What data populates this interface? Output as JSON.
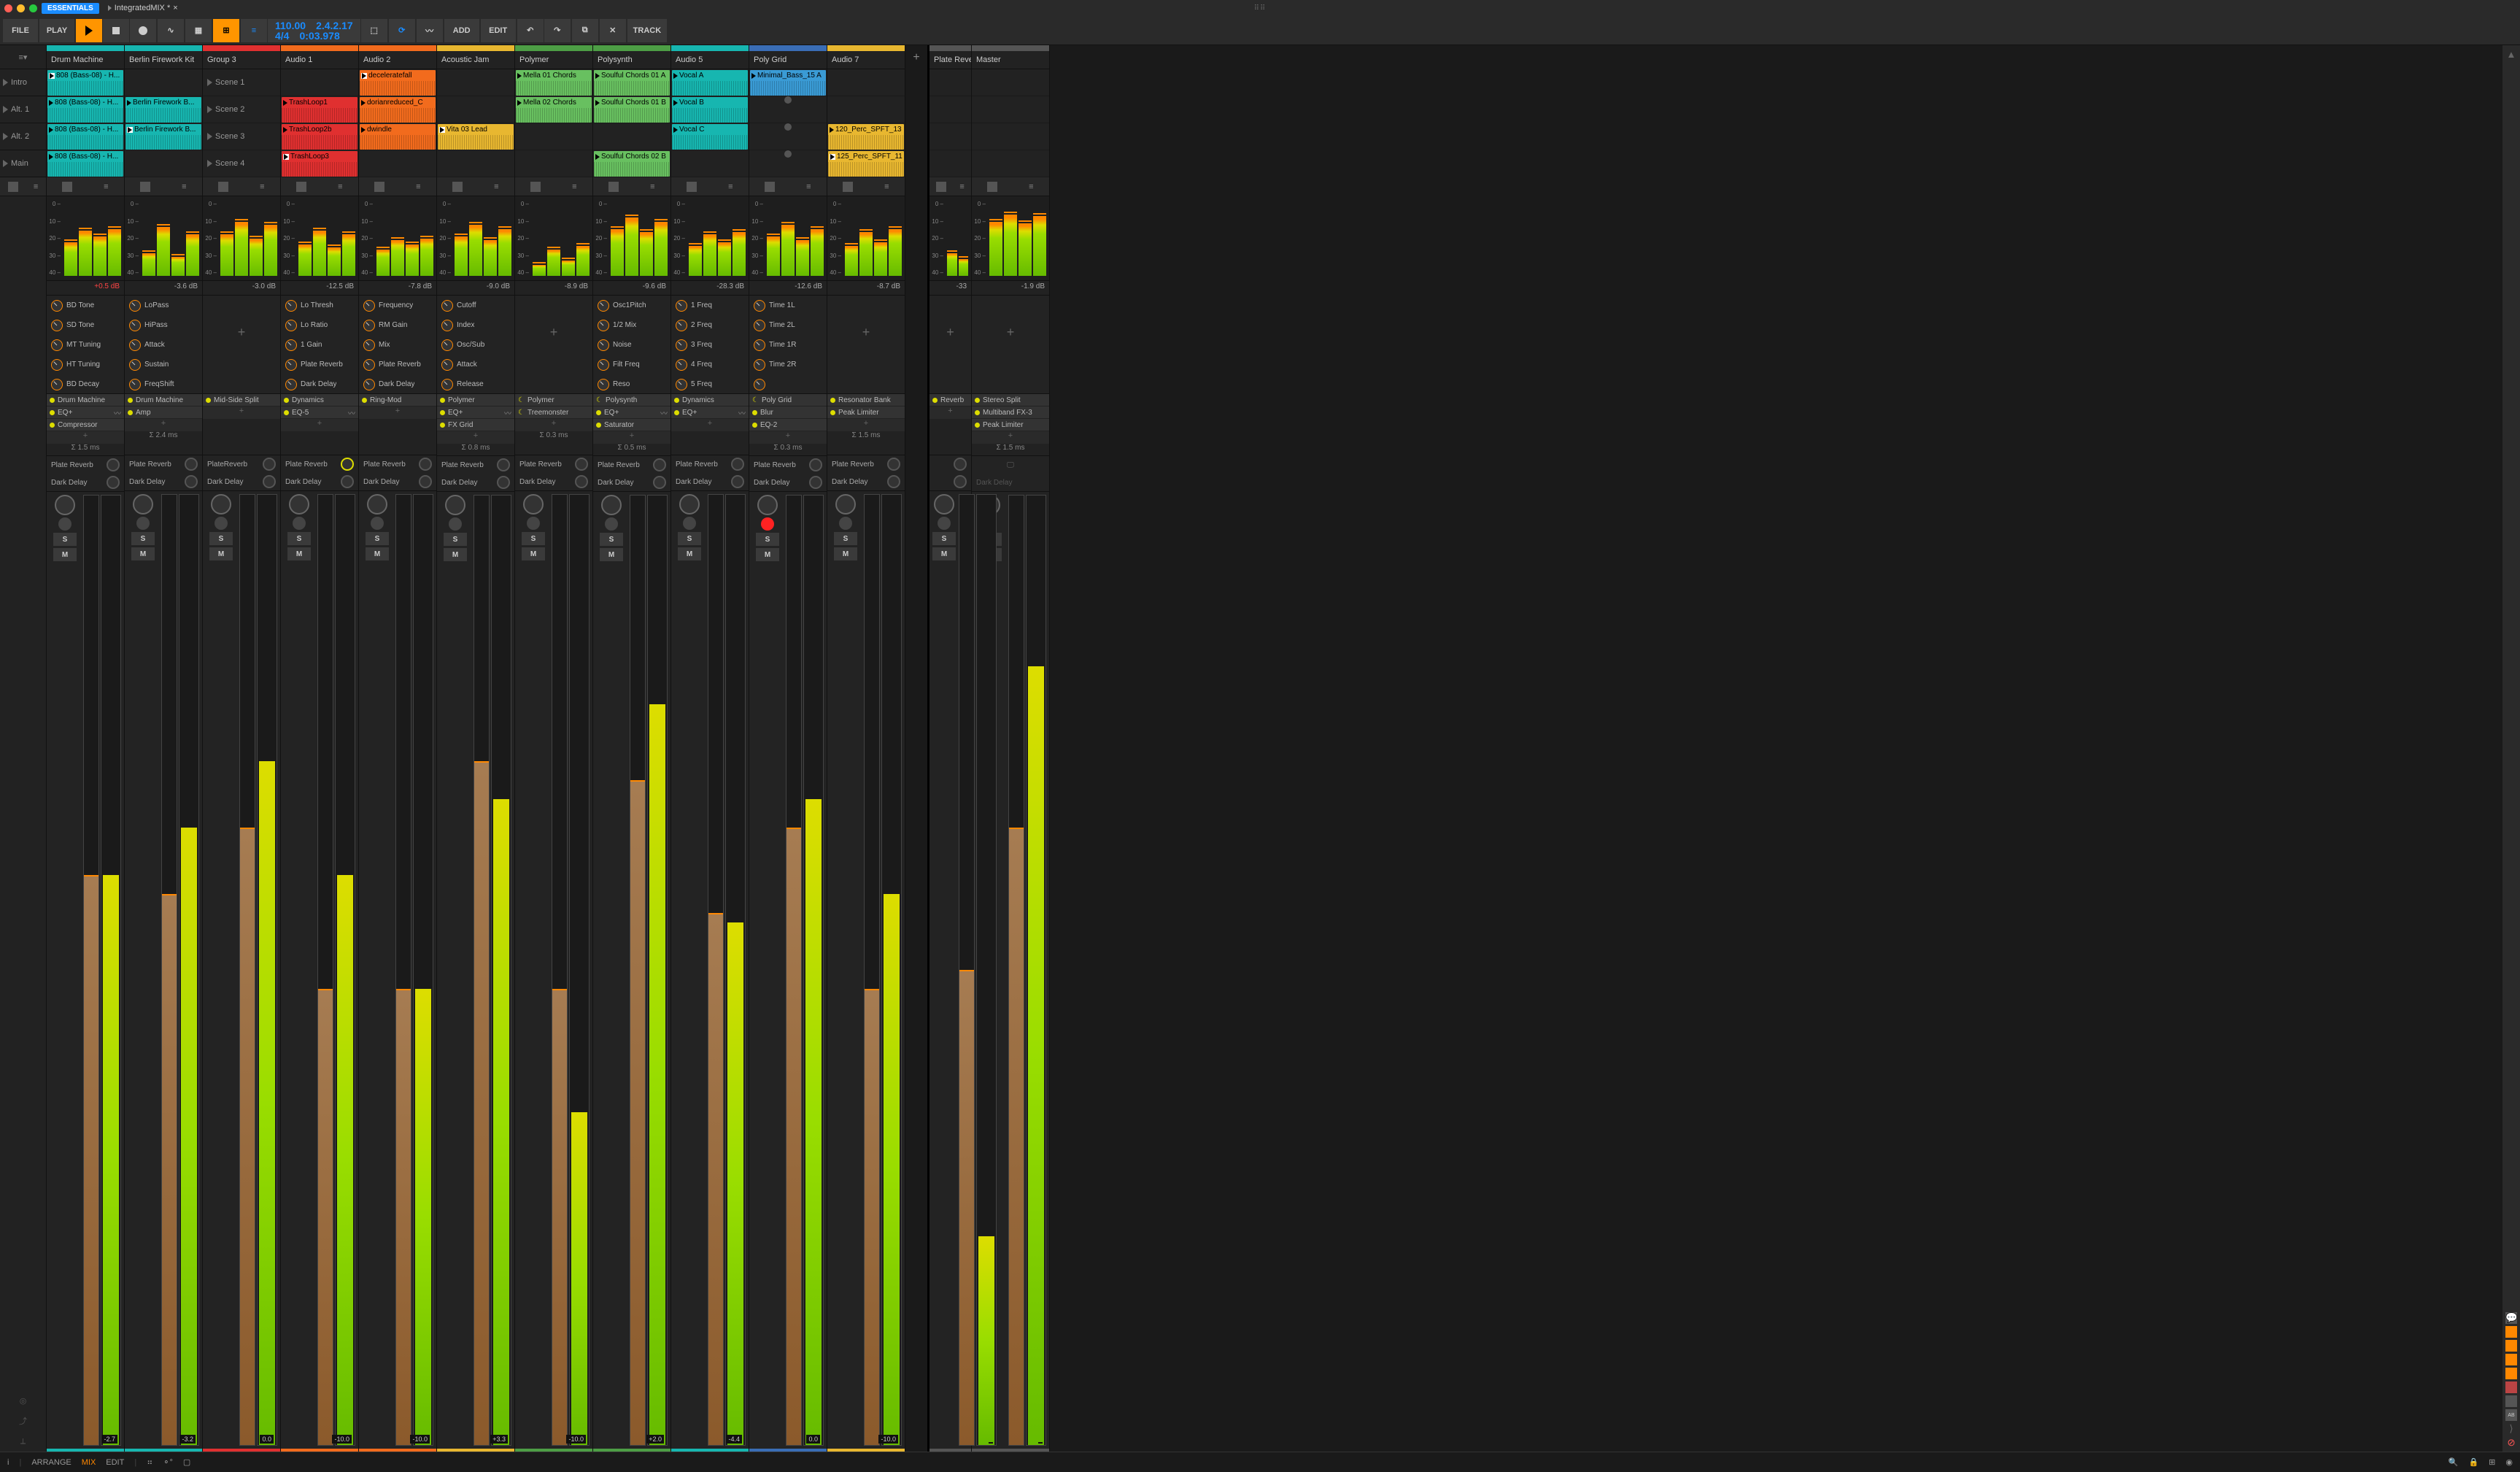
{
  "titlebar": {
    "badge": "ESSENTIALS",
    "project": "IntegratedMIX *",
    "close": "×"
  },
  "toolbar": {
    "file": "FILE",
    "play": "PLAY",
    "add": "ADD",
    "edit": "EDIT",
    "track": "TRACK",
    "tempo": "110.00",
    "sig": "4/4",
    "pos": "2.4.2.17",
    "time": "0:03.978"
  },
  "scenes": [
    "Intro",
    "Alt. 1",
    "Alt. 2",
    "Main"
  ],
  "meter_ticks": [
    "0",
    "10",
    "20",
    "30",
    "40"
  ],
  "tracks": [
    {
      "name": "Drum Machine",
      "color": "#17b6b0",
      "db": "+0.5 dB",
      "db_red": true,
      "clips": [
        {
          "label": "808 (Bass-08) - H...",
          "bg": "#17b6b0",
          "wp": true
        },
        {
          "label": "808 (Bass-08) - H...",
          "bg": "#17b6b0"
        },
        {
          "label": "808 (Bass-08) - H...",
          "bg": "#17b6b0"
        },
        {
          "label": "808 (Bass-08) - H...",
          "bg": "#17b6b0"
        }
      ],
      "knobs": [
        "BD Tone",
        "SD Tone",
        "MT Tuning",
        "HT Tuning",
        "BD Decay"
      ],
      "fx": [
        {
          "n": "Drum Machine"
        },
        {
          "n": "EQ+",
          "wave": true
        },
        {
          "n": "Compressor"
        }
      ],
      "latency": "Σ 1.5 ms",
      "sends": [
        "Plate Reverb",
        "Dark Delay"
      ],
      "meter": [
        45,
        60,
        52,
        62
      ],
      "fader": 60,
      "vol": "-2.7"
    },
    {
      "name": "Berlin Firework Kit",
      "color": "#17b6b0",
      "db": "-3.6 dB",
      "clips": [
        null,
        {
          "label": "Berlin Firework B...",
          "bg": "#17b6b0"
        },
        {
          "label": "Berlin Firework B...",
          "bg": "#17b6b0",
          "wp": true
        },
        null
      ],
      "knobs": [
        "LoPass",
        "HiPass",
        "Attack",
        "Sustain",
        "FreqShift"
      ],
      "fx": [
        {
          "n": "Drum Machine"
        },
        {
          "n": "Amp"
        }
      ],
      "latency": "Σ 2.4 ms",
      "sends": [
        "Plate Reverb",
        "Dark Delay"
      ],
      "meter": [
        30,
        65,
        25,
        55
      ],
      "fader": 58,
      "vol": "-3.2"
    },
    {
      "name": "Group 3",
      "color": "#e03030",
      "db": "-3.0 dB",
      "scenes": [
        "Scene 1",
        "Scene 2",
        "Scene 3",
        "Scene 4"
      ],
      "knobs_empty": true,
      "fx": [
        {
          "n": "Mid-Side Split"
        }
      ],
      "latency": "",
      "sends": [
        "PlateReverb",
        "Dark Delay"
      ],
      "meter": [
        55,
        72,
        50,
        68
      ],
      "fader": 65,
      "vol": "0.0"
    },
    {
      "name": "Audio 1",
      "color": "#f26b1d",
      "db": "-12.5 dB",
      "clips": [
        null,
        {
          "label": "TrashLoop1",
          "bg": "#e03030"
        },
        {
          "label": "TrashLoop2b",
          "bg": "#e03030"
        },
        {
          "label": "TrashLoop3",
          "bg": "#e03030",
          "wp": true
        }
      ],
      "knobs": [
        "Lo Thresh",
        "Lo Ratio",
        "1 Gain",
        "Plate Reverb",
        "Dark Delay"
      ],
      "fx": [
        {
          "n": "Dynamics"
        },
        {
          "n": "EQ-5",
          "wave": true
        }
      ],
      "latency": "",
      "sends": [
        "Plate Reverb",
        "Dark Delay"
      ],
      "send_active": [
        true,
        false
      ],
      "meter": [
        42,
        60,
        38,
        55
      ],
      "fader": 48,
      "vol": "-10.0"
    },
    {
      "name": "Audio 2",
      "color": "#f26b1d",
      "db": "-7.8 dB",
      "clips": [
        {
          "label": "deceleratefall",
          "bg": "#f26b1d",
          "wp": true
        },
        {
          "label": "dorianreduced_C",
          "bg": "#f26b1d"
        },
        {
          "label": "dwindle",
          "bg": "#f26b1d"
        },
        null
      ],
      "knobs": [
        "Frequency",
        "RM Gain",
        "Mix",
        "Plate Reverb",
        "Dark Delay"
      ],
      "fx": [
        {
          "n": "Ring-Mod"
        }
      ],
      "latency": "",
      "sends": [
        "Plate Reverb",
        "Dark Delay"
      ],
      "meter": [
        35,
        48,
        42,
        50
      ],
      "fader": 48,
      "vol": "-10.0"
    },
    {
      "name": "Acoustic Jam",
      "color": "#e8b730",
      "db": "-9.0 dB",
      "clips": [
        null,
        null,
        {
          "label": "Vita 03 Lead",
          "bg": "#e8b730",
          "wp": true
        },
        null
      ],
      "knobs": [
        "Cutoff",
        "Index",
        "Osc/Sub",
        "Attack",
        "Release"
      ],
      "fx": [
        {
          "n": "Polymer"
        },
        {
          "n": "EQ+",
          "wave": true
        },
        {
          "n": "FX Grid"
        }
      ],
      "latency": "Σ 0.8 ms",
      "sends": [
        "Plate Reverb",
        "Dark Delay"
      ],
      "meter": [
        52,
        68,
        48,
        62
      ],
      "fader": 72,
      "vol": "+3.3"
    },
    {
      "name": "Polymer",
      "color": "#4d9e45",
      "db": "-8.9 dB",
      "clips": [
        {
          "label": "Mella 01 Chords",
          "bg": "#68c060"
        },
        {
          "label": "Mella 02 Chords",
          "bg": "#68c060"
        },
        null,
        null
      ],
      "knobs_empty": true,
      "fx": [
        {
          "n": "Polymer",
          "moon": true
        },
        {
          "n": "Treemonster",
          "moon": true
        }
      ],
      "latency": "Σ 0.3 ms",
      "sends": [
        "Plate Reverb",
        "Dark Delay"
      ],
      "meter": [
        15,
        35,
        20,
        40
      ],
      "fader": 48,
      "vol": "-10.0"
    },
    {
      "name": "Polysynth",
      "color": "#4d9e45",
      "db": "-9.6 dB",
      "clips": [
        {
          "label": "Soulful Chords 01 A",
          "bg": "#68c060"
        },
        {
          "label": "Soulful Chords 01 B",
          "bg": "#68c060"
        },
        null,
        {
          "label": "Soulful Chords 02 B",
          "bg": "#68c060"
        }
      ],
      "knobs": [
        "Osc1Pitch",
        "1/2 Mix",
        "Noise",
        "Filt Freq",
        "Reso"
      ],
      "fx": [
        {
          "n": "Polysynth",
          "moon": true
        },
        {
          "n": "EQ+",
          "wave": true
        },
        {
          "n": "Saturator"
        }
      ],
      "latency": "Σ 0.5 ms",
      "sends": [
        "Plate Reverb",
        "Dark Delay"
      ],
      "meter": [
        62,
        78,
        58,
        72
      ],
      "fader": 70,
      "vol": "+2.0"
    },
    {
      "name": "Audio 5",
      "color": "#17b6b0",
      "db": "-28.3 dB",
      "clips": [
        {
          "label": "Vocal A",
          "bg": "#17b6b0"
        },
        {
          "label": "Vocal B",
          "bg": "#17b6b0"
        },
        {
          "label": "Vocal C",
          "bg": "#17b6b0"
        },
        null
      ],
      "knobs": [
        "1 Freq",
        "2 Freq",
        "3 Freq",
        "4 Freq",
        "5 Freq"
      ],
      "fx": [
        {
          "n": "Dynamics"
        },
        {
          "n": "EQ+",
          "wave": true
        }
      ],
      "latency": "",
      "sends": [
        "Plate Reverb",
        "Dark Delay"
      ],
      "meter": [
        40,
        55,
        45,
        58
      ],
      "fader": 56,
      "vol": "-4.4"
    },
    {
      "name": "Poly Grid",
      "color": "#3a6db5",
      "db": "-12.6 dB",
      "clips": [
        {
          "label": "Minimal_Bass_15 A",
          "bg": "#3a9bd5"
        },
        {
          "rec": true
        },
        {
          "rec": true
        },
        {
          "rec": true
        }
      ],
      "knobs": [
        "Time 1L",
        "Time 2L",
        "Time 1R",
        "Time 2R",
        ""
      ],
      "fx": [
        {
          "n": "Poly Grid",
          "moon": true
        },
        {
          "n": "Blur"
        },
        {
          "n": "EQ-2"
        }
      ],
      "latency": "Σ 0.3 ms",
      "sends": [
        "Plate Reverb",
        "Dark Delay"
      ],
      "meter": [
        52,
        68,
        48,
        62
      ],
      "fader": 65,
      "vol": "0.0",
      "armed": true
    },
    {
      "name": "Audio 7",
      "color": "#e8b730",
      "db": "-8.7 dB",
      "clips": [
        null,
        null,
        {
          "label": "120_Perc_SPFT_13",
          "bg": "#e8b730"
        },
        {
          "label": "125_Perc_SPFT_11",
          "bg": "#e8b730",
          "wp": true
        }
      ],
      "knobs_empty": true,
      "fx": [
        {
          "n": "Resonator Bank"
        },
        {
          "n": "Peak Limiter"
        }
      ],
      "latency": "Σ 1.5 ms",
      "sends": [
        "Plate Reverb",
        "Dark Delay"
      ],
      "meter": [
        40,
        58,
        45,
        62
      ],
      "fader": 48,
      "vol": "-10.0"
    }
  ],
  "fx_tracks": [
    {
      "name": "Plate Rever",
      "color": "#555",
      "db": "-33",
      "fx": [
        {
          "n": "Reverb"
        }
      ],
      "latency": "",
      "meter": [
        30,
        22
      ],
      "fader": 50,
      "vol": ""
    }
  ],
  "master": {
    "name": "Master",
    "color": "#555",
    "db": "-1.9 dB",
    "fx": [
      {
        "n": "Stereo Split"
      },
      {
        "n": "Multiband FX-3"
      },
      {
        "n": "Peak Limiter"
      }
    ],
    "latency": "Σ 1.5 ms",
    "sends": [
      "",
      "Dark Delay"
    ],
    "meter": [
      72,
      82,
      70,
      80
    ],
    "fader": 65,
    "vol": ""
  },
  "footer": {
    "info": "i",
    "arrange": "ARRANGE",
    "mix": "MIX",
    "edit": "EDIT"
  }
}
